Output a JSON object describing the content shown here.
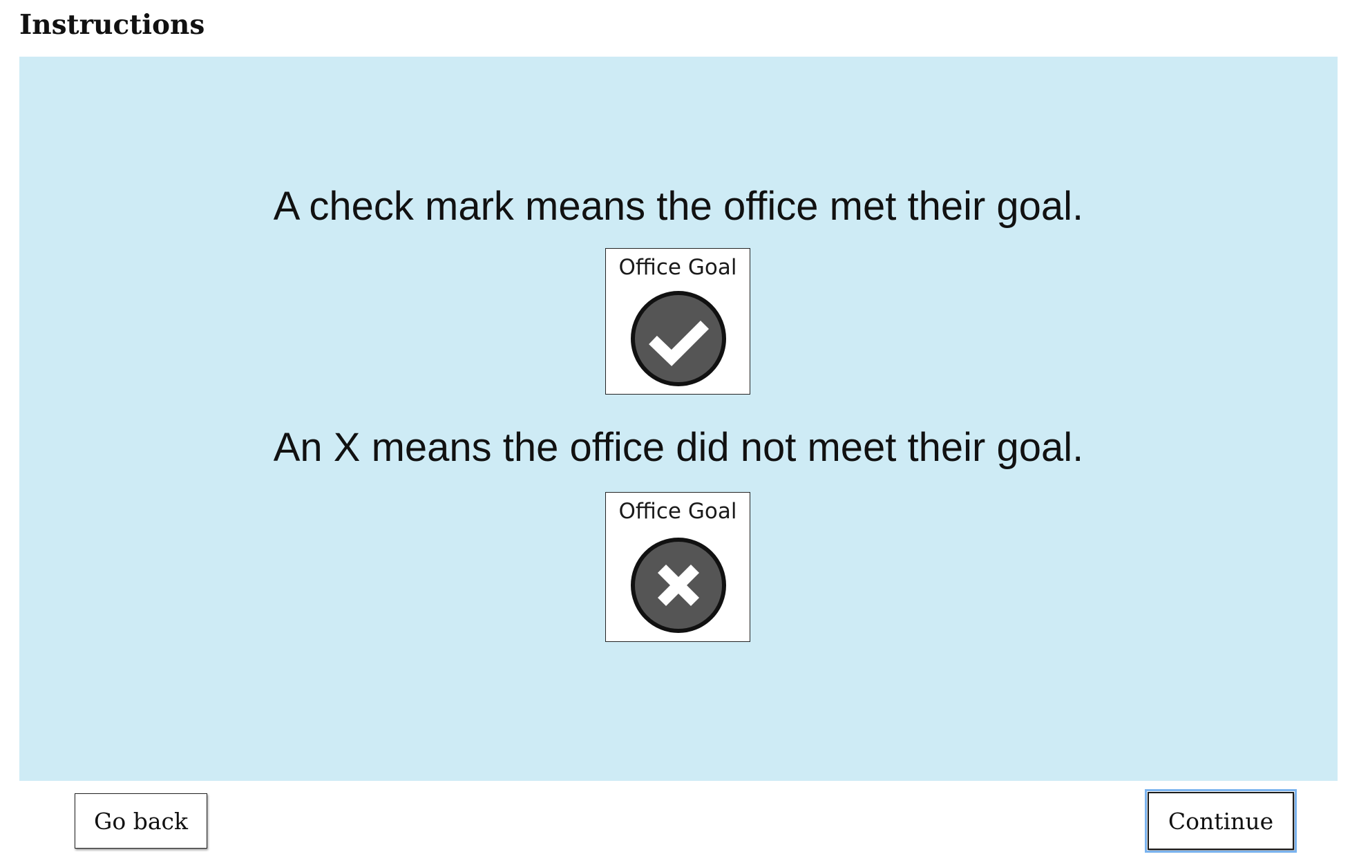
{
  "page": {
    "title": "Instructions"
  },
  "panel": {
    "background": "#ceebf5",
    "met_statement": "A check mark means the office met their goal.",
    "not_met_statement": "An X means the office did not meet their goal.",
    "met_card": {
      "label": "Office Goal",
      "icon": "check-mark-icon"
    },
    "not_met_card": {
      "label": "Office Goal",
      "icon": "x-mark-icon"
    }
  },
  "navigation": {
    "back_label": "Go back",
    "continue_label": "Continue",
    "focus_color": "#7ab3ef"
  }
}
